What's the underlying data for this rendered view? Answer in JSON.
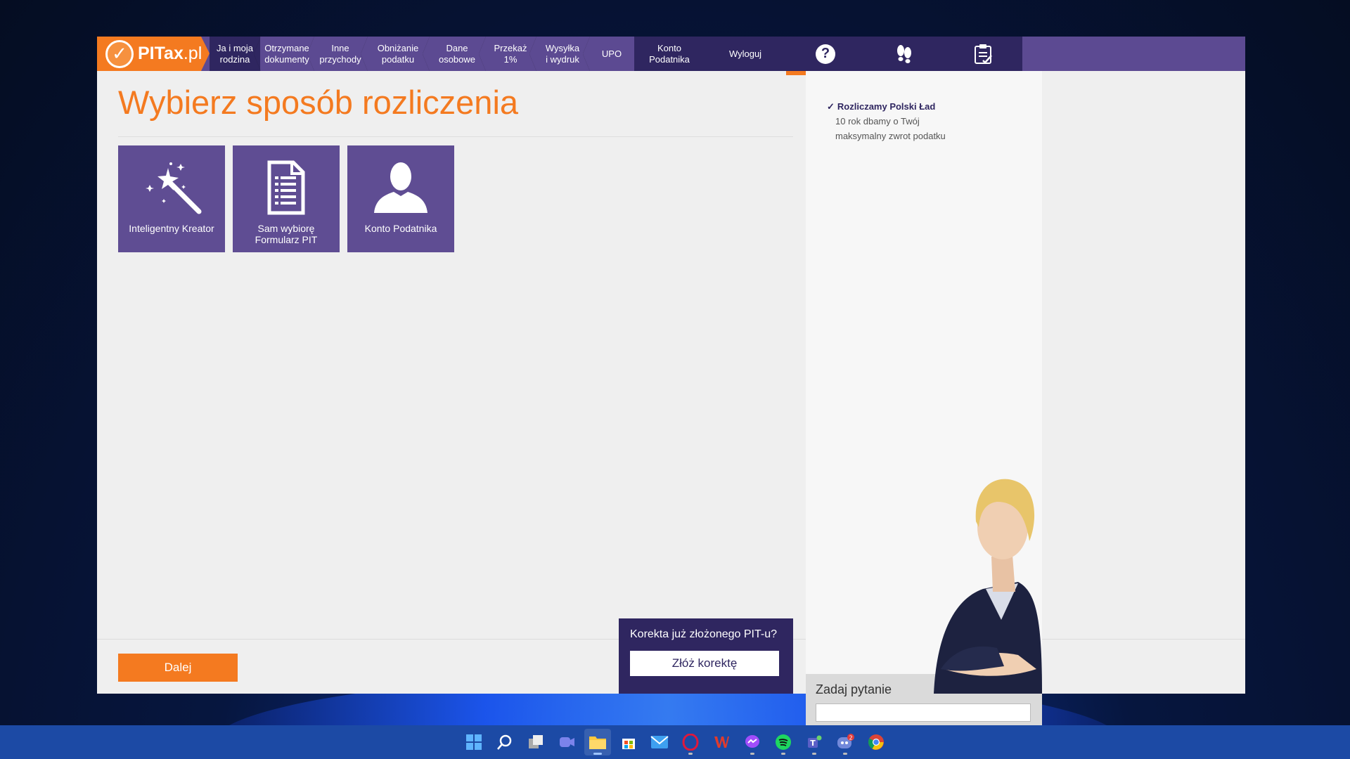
{
  "nav": {
    "logo_text": "PITax",
    "logo_suffix": ".pl",
    "items": [
      {
        "label": "Ja i moja\nrodzina"
      },
      {
        "label": "Otrzymane\ndokumenty"
      },
      {
        "label": "Inne\nprzychody"
      },
      {
        "label": "Obniżanie\npodatku"
      },
      {
        "label": "Dane\nosobowe"
      },
      {
        "label": "Przekaż\n1%"
      },
      {
        "label": "Wysyłka\ni wydruk"
      },
      {
        "label": "UPO"
      },
      {
        "label": "Konto\nPodatnika"
      },
      {
        "label": "Wyloguj"
      }
    ],
    "tools": [
      {
        "icon": "help-icon"
      },
      {
        "icon": "footsteps-icon"
      },
      {
        "icon": "clipboard-icon"
      }
    ]
  },
  "main": {
    "title": "Wybierz sposób rozliczenia",
    "tiles": [
      {
        "label": "Inteligentny Kreator",
        "icon": "magic-wand-icon"
      },
      {
        "label": "Sam wybiorę\nFormularz PIT",
        "icon": "document-icon"
      },
      {
        "label": "Konto Podatnika",
        "icon": "user-icon"
      }
    ],
    "next_button": "Dalej"
  },
  "correction": {
    "title": "Korekta już złożonego PIT-u?",
    "button": "Złóż korektę"
  },
  "side": {
    "item_head": "Rozliczamy Polski Ład",
    "item_body": "10 rok dbamy o Twój\nmaksymalny zwrot podatku",
    "question_label": "Zadaj pytanie",
    "question_placeholder": ""
  },
  "colors": {
    "brand_orange": "#f47a20",
    "brand_purple": "#5c4a92",
    "brand_dark": "#2f2660"
  },
  "taskbar": {
    "icons": [
      "start-icon",
      "search-icon",
      "task-view-icon",
      "chat-icon",
      "file-explorer-icon",
      "store-icon",
      "mail-icon",
      "opera-icon",
      "office-icon",
      "messenger-icon",
      "spotify-icon",
      "teams-icon",
      "discord-icon",
      "chrome-icon"
    ],
    "discord_badge": "2"
  }
}
